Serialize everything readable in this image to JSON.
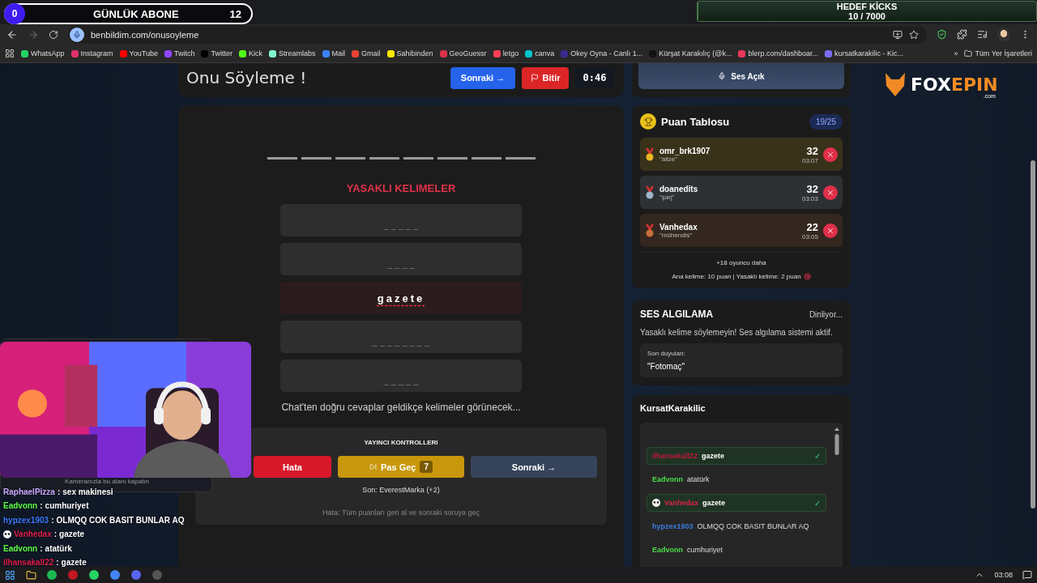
{
  "stream_overlay": {
    "daily_subs": {
      "count": "0",
      "label": "GÜNLÜK ABONE",
      "goal": "12"
    },
    "kicks_goal": {
      "label": "HEDEF KİCKS",
      "progress": "10 / 7000",
      "level": 0.0014
    }
  },
  "browser": {
    "url": "benbildim.com/onusoyleme",
    "bookmarks": [
      {
        "label": "WhatsApp",
        "color": "#25d366"
      },
      {
        "label": "Instagram",
        "color": "#e1306c"
      },
      {
        "label": "YouTube",
        "color": "#ff0000"
      },
      {
        "label": "Twitch",
        "color": "#9146ff"
      },
      {
        "label": "Twitter",
        "color": "#000000"
      },
      {
        "label": "Kick",
        "color": "#53fc18"
      },
      {
        "label": "Streamlabs",
        "color": "#80f5d2"
      },
      {
        "label": "Mail",
        "color": "#3b82f6"
      },
      {
        "label": "Gmail",
        "color": "#ea4335"
      },
      {
        "label": "Sahibinden",
        "color": "#ffe800"
      },
      {
        "label": "GeoGuessr",
        "color": "#d9334a"
      },
      {
        "label": "letgo",
        "color": "#ff3f55"
      },
      {
        "label": "canva",
        "color": "#00c4cc"
      },
      {
        "label": "Okey Oyna - Canlı 1...",
        "color": "#3b2a8f"
      },
      {
        "label": "Kürşat Karakılıç (@k...",
        "color": "#111111"
      },
      {
        "label": "blerp.com/dashboar...",
        "color": "#e8385a"
      },
      {
        "label": "kursatkarakilic - Kic...",
        "color": "#7c6cf0"
      }
    ],
    "more": "»",
    "all_bookmarks": "Tüm Yer İşaretleri"
  },
  "game": {
    "title": "Onu Söyleme !",
    "next_button": "Sonraki →",
    "finish_button": "Bitir",
    "timer": "0:46",
    "answer_slots": [
      {
        "filled": false
      },
      {
        "filled": false
      },
      {
        "filled": false
      },
      {
        "filled": false
      },
      {
        "filled": false
      },
      {
        "filled": false
      },
      {
        "filled": false
      },
      {
        "filled": false
      }
    ],
    "forbidden_title": "YASAKLI KELIMELER",
    "forbidden_words": [
      {
        "text": "_ _ _ _ _",
        "revealed": false
      },
      {
        "text": "_ _ _ _",
        "revealed": false
      },
      {
        "text": "gazete",
        "revealed": true
      },
      {
        "text": "_ _ _ _ _ _ _ _",
        "revealed": false
      },
      {
        "text": "_ _ _ _ _",
        "revealed": false
      }
    ],
    "hint": "Chat'ten doğru cevaplar geldikçe kelimeler görünecek...",
    "controls": {
      "title": "YAYINCI KONTROLLERI",
      "error_button": "Hata",
      "pass_button": "Pas Geç",
      "pass_count": "7",
      "next_button": "Sonraki →",
      "last": "Son: EverestMarka (+2)",
      "note": "Hata: Tüm puanları geri al ve sonraki soruya geç"
    }
  },
  "sound_button": "Ses Açık",
  "leaderboard": {
    "title": "Puan Tablosu",
    "count": "19/25",
    "entries": [
      {
        "name": "omr_brk1907",
        "word": "\"alize\"",
        "score": "32",
        "time": "03:07",
        "color": "#e8b923"
      },
      {
        "name": "doanedits",
        "word": "\"şarj\"",
        "score": "32",
        "time": "03:03",
        "color": "#9fb4c8"
      },
      {
        "name": "Vanhedax",
        "word": "\"mühendis\"",
        "score": "22",
        "time": "03:05",
        "color": "#c8703a"
      }
    ],
    "more_players": "+18 oyuncu daha",
    "rules": "Ana kelime: 10 puan | Yasaklı kelime: 2 puan"
  },
  "voice_detection": {
    "title": "SES ALGILAMA",
    "status": "Dinliyor...",
    "warning": "Yasaklı kelime söylemeyin! Ses algılama sistemi aktif.",
    "last_heard_label": "Son duyulan:",
    "last_heard": "\"Fotomaç\""
  },
  "chat_panel": {
    "title": "KursatKarakilic",
    "messages": [
      {
        "name": "ilhansakall22",
        "text": "gazete",
        "color": "#c0183c",
        "correct": true,
        "badge": false
      },
      {
        "name": "Eadvonn",
        "text": "atatürk",
        "color": "#4ade4a",
        "correct": false,
        "badge": false
      },
      {
        "name": "Vanhedax",
        "text": "gazete",
        "color": "#e0204a",
        "correct": true,
        "badge": true
      },
      {
        "name": "hypzex1903",
        "text": "OLMQQ COK BASIT BUNLAR AQ",
        "color": "#3b7bdc",
        "correct": false,
        "badge": false
      },
      {
        "name": "Eadvonn",
        "text": "cumhuriyet",
        "color": "#4ade4a",
        "correct": false,
        "badge": false
      }
    ],
    "check": "✓"
  },
  "logo": {
    "main": "FOX",
    "accent": "EPIN",
    "suffix": ".com"
  },
  "webcam": {
    "kind": "picture",
    "caption": "Kameranızla bu alanı kapatın"
  },
  "chat_overlay": {
    "separator": ":",
    "messages": [
      {
        "name": "RaphaelPizza",
        "text": "sex makinesi",
        "color": "#c8a8ff",
        "badge": false
      },
      {
        "name": "Eadvonn",
        "text": "cumhuriyet",
        "color": "#5cff4a",
        "badge": false
      },
      {
        "name": "hypzex1903",
        "text": "OLMQQ COK BASIT BUNLAR AQ",
        "color": "#3b7bff",
        "badge": false
      },
      {
        "name": "Vanhedax",
        "text": "gazete",
        "color": "#e0204a",
        "badge": true
      },
      {
        "name": "Eadvonn",
        "text": "atatürk",
        "color": "#5cff4a",
        "badge": false
      },
      {
        "name": "ilhansakall22",
        "text": "gazete",
        "color": "#e0204a",
        "badge": false
      }
    ]
  },
  "taskbar": {
    "time": "03:08"
  }
}
